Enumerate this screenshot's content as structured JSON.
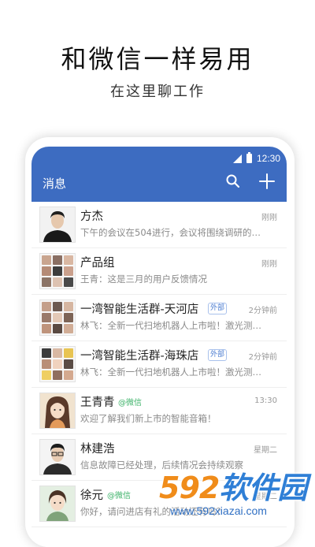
{
  "hero": {
    "title": "和微信一样易用",
    "subtitle": "在这里聊工作"
  },
  "status_bar": {
    "time": "12:30",
    "icons": [
      "signal-icon",
      "battery-icon"
    ]
  },
  "app_bar": {
    "title": "消息",
    "background": "#3d6cc1",
    "actions": [
      "search-icon",
      "plus-icon"
    ]
  },
  "chats": [
    {
      "name": "方杰",
      "preview": "下午的会议在504进行，会议将围绕调研的…",
      "time": "刚刚",
      "avatar": "person-avatar"
    },
    {
      "name": "产品组",
      "preview": "王青：这是三月的用户反馈情况",
      "time": "刚刚",
      "avatar": "group-avatar"
    },
    {
      "name": "一湾智能生活群-天河店",
      "badge": "外部",
      "preview": "林飞：全新一代扫地机器人上市啦！激光测…",
      "time": "2分钟前",
      "avatar": "group-avatar"
    },
    {
      "name": "一湾智能生活群-海珠店",
      "badge": "外部",
      "preview": "林飞：全新一代扫地机器人上市啦！激光测…",
      "time": "2分钟前",
      "avatar": "group-avatar"
    },
    {
      "name": "王青青",
      "badge": "@微信",
      "preview": "欢迎了解我们新上市的智能音箱！",
      "time": "13:30",
      "avatar": "illustrated-avatar"
    },
    {
      "name": "林建浩",
      "preview": "信息故障已经处理，后续情况会持续观察",
      "time": "星期二",
      "avatar": "person-avatar"
    },
    {
      "name": "徐元",
      "badge": "@微信",
      "preview": "你好，请问进店有礼的活动还有吗？",
      "time": "星期二",
      "avatar": "illustrated-avatar"
    }
  ],
  "watermark": {
    "logo_a": "592",
    "logo_b": "软件园",
    "url": "www.592xiazai.com"
  }
}
